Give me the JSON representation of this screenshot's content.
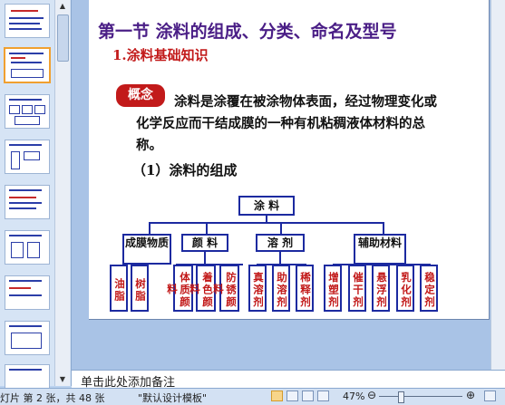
{
  "slide": {
    "title": "第一节  涂料的组成、分类、命名及型号",
    "subtitle": "1.涂料基础知识",
    "concept_label": "概念",
    "definition": "涂料是涂覆在被涂物体表面，经过物理变化或化学反应而干结成膜的一种有机粘稠液体材料的总称。",
    "section_heading": "（1）涂料的组成"
  },
  "diagram": {
    "root": "涂  料",
    "groups": [
      {
        "label": "成膜物质",
        "children": [
          "油脂",
          "树脂"
        ]
      },
      {
        "label": "颜  料",
        "children": [
          "体质颜料",
          "着色颜料",
          "防锈颜料"
        ]
      },
      {
        "label": "溶  剂",
        "children": [
          "真溶剂",
          "助溶剂",
          "稀释剂"
        ]
      },
      {
        "label": "辅助材料",
        "children": [
          "增塑剂",
          "催干剂",
          "悬浮剂",
          "乳化剂",
          "稳定剂"
        ]
      }
    ]
  },
  "notes": {
    "placeholder": "单击此处添加备注"
  },
  "status": {
    "slide_info": "灯片 第 2 张，共 48 张",
    "template": "\"默认设计模板\"",
    "zoom": "47%",
    "zoom_minus": "⊖",
    "zoom_plus": "⊕"
  },
  "colors": {
    "title": "#4a1e86",
    "accent": "#c21a1a",
    "box_border": "#1c2aa0"
  }
}
